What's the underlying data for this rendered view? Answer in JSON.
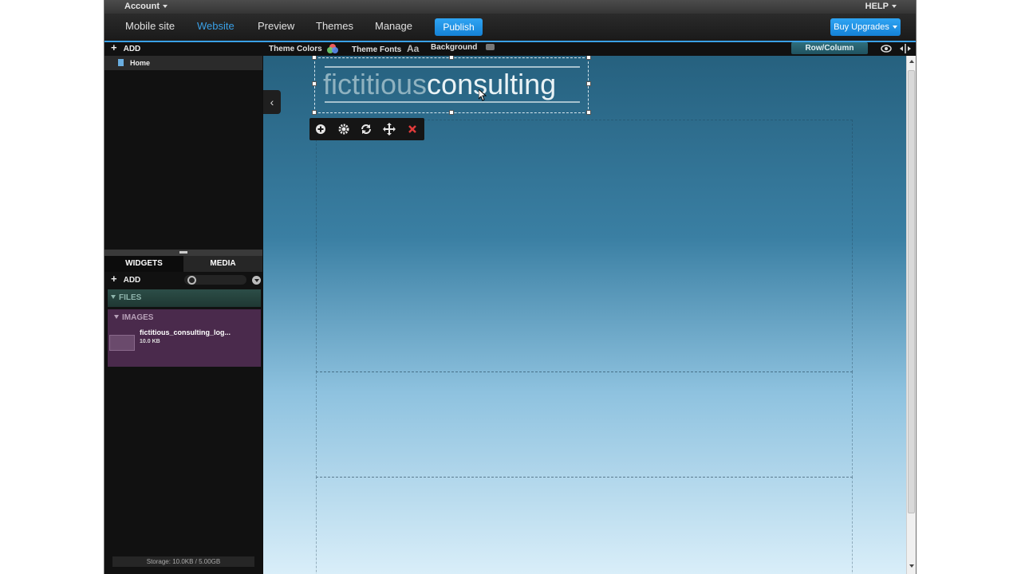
{
  "topbar": {
    "account": "Account",
    "help": "HELP"
  },
  "nav": {
    "items": [
      "Mobile site",
      "Website",
      "Preview",
      "Themes",
      "Manage"
    ],
    "active": "Website",
    "publish": "Publish",
    "upgrade": "Buy Upgrades"
  },
  "toolbar": {
    "add": "ADD",
    "theme_colors": "Theme Colors",
    "theme_fonts": "Theme Fonts",
    "theme_fonts_glyph": "Aa",
    "background": "Background",
    "row_column": "Row/Column Editing"
  },
  "pages": {
    "items": [
      {
        "label": "Home"
      }
    ]
  },
  "widgets_panel": {
    "tab_widgets": "WIDGETS",
    "tab_media": "MEDIA",
    "add": "ADD",
    "files_header": "FILES",
    "images_header": "IMAGES",
    "image": {
      "name": "fictitious_consulting_log...",
      "size": "10.0 KB"
    }
  },
  "storage": "Storage: 10.0KB / 5.00GB",
  "canvas": {
    "logo": {
      "part1": "fictitious",
      "part2": "consulting"
    }
  },
  "colors": {
    "accent": "#2fa4f3",
    "delete": "#e23b3b",
    "files_bg": "#2c4d47",
    "images_bg": "#4a2a4c"
  }
}
